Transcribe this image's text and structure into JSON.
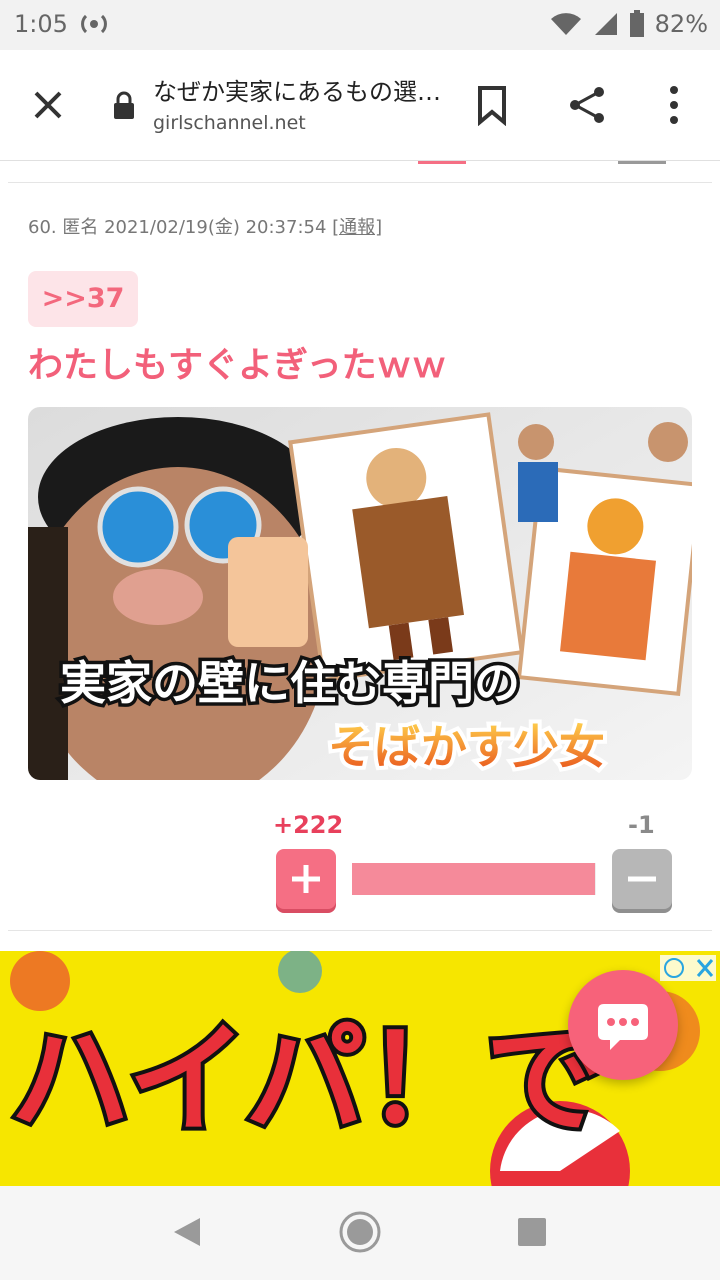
{
  "status_bar": {
    "time": "1:05",
    "battery_percent": "82%"
  },
  "browser": {
    "page_title": "なぜか実家にあるもの選…",
    "url": "girlschannel.net"
  },
  "post": {
    "meta": "60. 匿名 2021/02/19(金) 20:37:54 ",
    "report_label": "[通報]",
    "anchor": ">>37",
    "text": "わたしもすぐよぎったｗｗ",
    "image_caption_line1": "実家の壁に住む専門の",
    "image_caption_line2": "そばかす少女",
    "vote_plus": "+222",
    "vote_minus": "-1",
    "vote_plus_symbol": "+",
    "vote_minus_symbol": "−",
    "vote_ratio": 0.996
  },
  "ad": {
    "text": "ハイパ！で"
  },
  "colors": {
    "accent": "#f56f84",
    "comment_text": "#f2607a",
    "ad_bg": "#f6e600"
  },
  "icons": [
    "close-icon",
    "lock-icon",
    "bookmark-icon",
    "share-icon",
    "more-icon",
    "chat-icon",
    "back-icon",
    "home-icon",
    "recent-icon",
    "adchoices-icon"
  ]
}
